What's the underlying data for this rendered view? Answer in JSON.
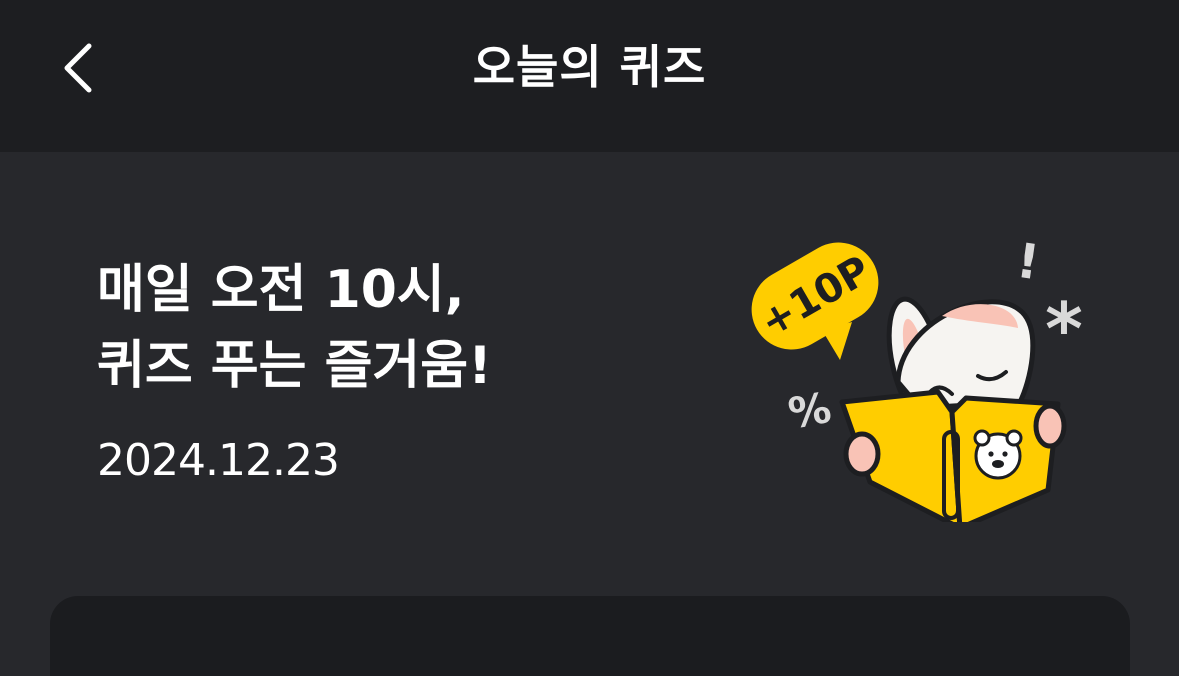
{
  "header": {
    "title": "오늘의 퀴즈",
    "back_icon": "chevron-left-icon"
  },
  "hero": {
    "title_line1": "매일 오전 10시,",
    "title_line2": "퀴즈 푸는 즐거움!",
    "date": "2024.12.23",
    "badge_label": "+10P",
    "symbol_exclaim": "!",
    "symbol_percent": "%",
    "symbol_asterisk": "*"
  },
  "colors": {
    "header_bg": "#1d1e21",
    "page_bg": "#27282c",
    "card_bg": "#1b1c1f",
    "accent_yellow": "#ffcd00",
    "text": "#ffffff"
  }
}
